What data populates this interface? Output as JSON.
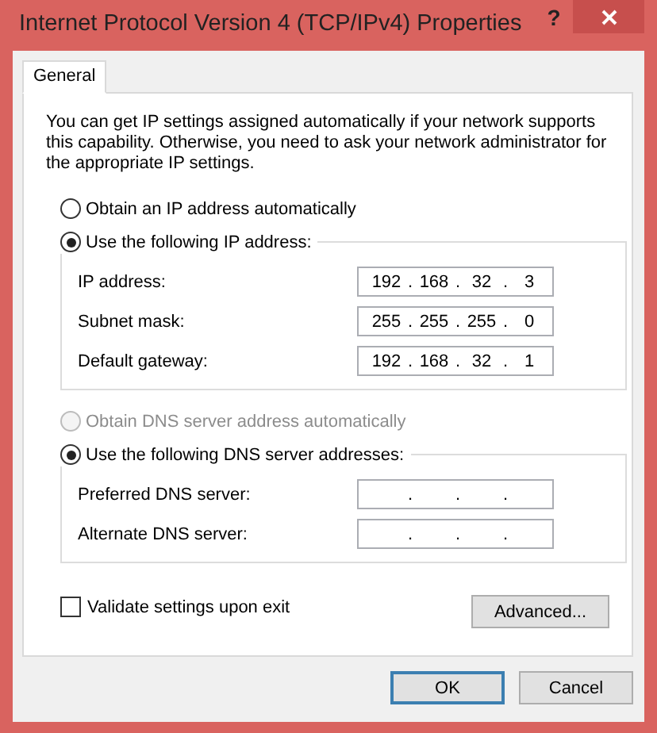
{
  "window": {
    "title": "Internet Protocol Version 4 (TCP/IPv4) Properties",
    "help": "?"
  },
  "tabs": [
    {
      "label": "General",
      "selected": true
    }
  ],
  "description": "You can get IP settings assigned automatically if your network supports this capability. Otherwise, you need to ask your network administrator for the appropriate IP settings.",
  "ip_options": [
    {
      "label": "Obtain an IP address automatically",
      "selected": false
    },
    {
      "label": "Use the following IP address:",
      "selected": true
    }
  ],
  "ip_fields": [
    {
      "label": "IP address:",
      "octets": [
        "192",
        "168",
        "32",
        "3"
      ],
      "dots": [
        ".",
        ".",
        "."
      ]
    },
    {
      "label": "Subnet mask:",
      "octets": [
        "255",
        "255",
        "255",
        "0"
      ],
      "dots": [
        ".",
        ".",
        "."
      ]
    },
    {
      "label": "Default gateway:",
      "octets": [
        "192",
        "168",
        "32",
        "1"
      ],
      "dots": [
        ".",
        ".",
        "."
      ]
    }
  ],
  "dns_options": [
    {
      "label": "Obtain DNS server address automatically",
      "selected": false,
      "disabled": true
    },
    {
      "label": "Use the following DNS server addresses:",
      "selected": true,
      "disabled": false
    }
  ],
  "dns_fields": [
    {
      "label": "Preferred DNS server:",
      "dots": [
        ".",
        ".",
        "."
      ]
    },
    {
      "label": "Alternate DNS server:",
      "dots": [
        ".",
        ".",
        "."
      ]
    }
  ],
  "validate": {
    "label": "Validate settings upon exit",
    "checked": false
  },
  "advanced_button": "Advanced...",
  "buttons": [
    {
      "label": "OK",
      "default": true
    },
    {
      "label": "Cancel",
      "default": false
    }
  ]
}
